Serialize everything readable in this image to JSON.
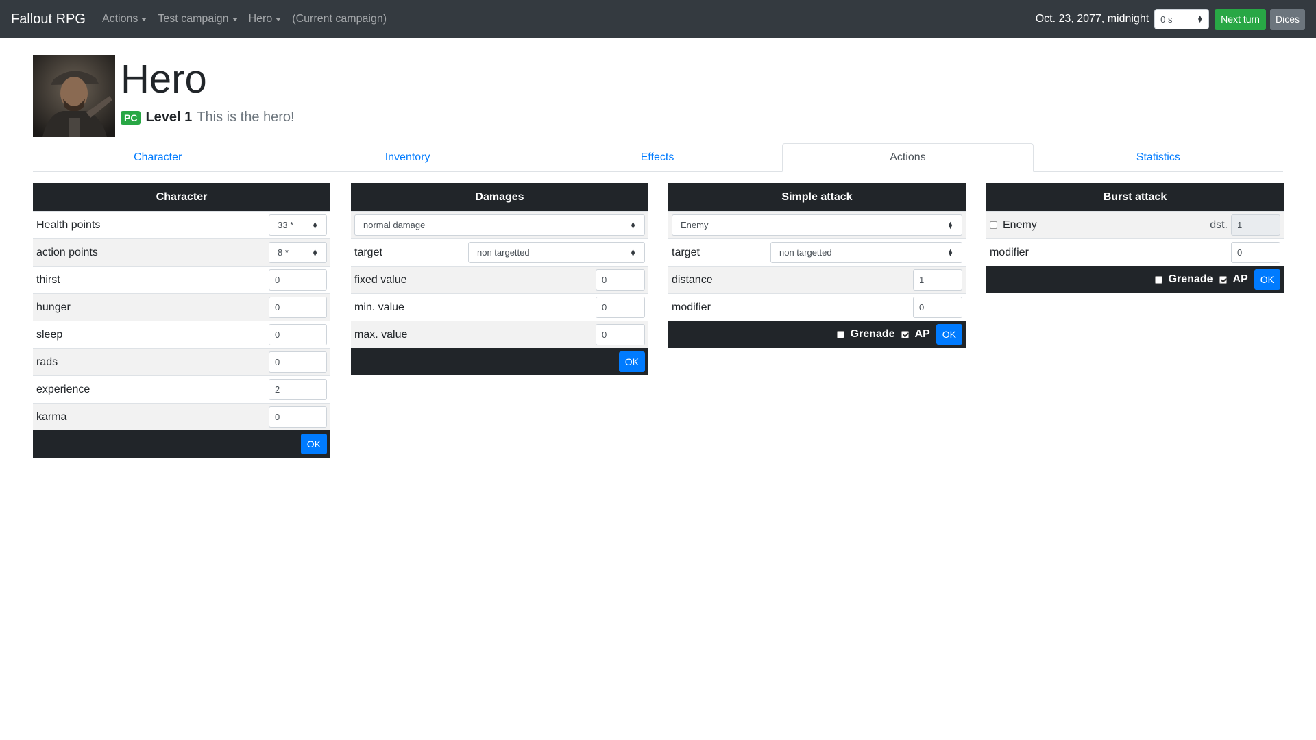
{
  "nav": {
    "brand": "Fallout RPG",
    "menus": [
      "Actions",
      "Test campaign",
      "Hero"
    ],
    "current_campaign": "(Current campaign)",
    "date": "Oct. 23, 2077, midnight",
    "time_select": "0 s",
    "next_turn": "Next turn",
    "dices": "Dices"
  },
  "header": {
    "name": "Hero",
    "badge": "PC",
    "level_label": "Level",
    "level_value": "1",
    "description": "This is the hero!"
  },
  "tabs": [
    {
      "label": "Character",
      "active": false
    },
    {
      "label": "Inventory",
      "active": false
    },
    {
      "label": "Effects",
      "active": false
    },
    {
      "label": "Actions",
      "active": true
    },
    {
      "label": "Statistics",
      "active": false
    }
  ],
  "character": {
    "title": "Character",
    "rows": [
      {
        "label": "Health points",
        "value": "33 *",
        "type": "select"
      },
      {
        "label": "action points",
        "value": "8 *",
        "type": "select"
      },
      {
        "label": "thirst",
        "value": "0"
      },
      {
        "label": "hunger",
        "value": "0"
      },
      {
        "label": "sleep",
        "value": "0"
      },
      {
        "label": "rads",
        "value": "0"
      },
      {
        "label": "experience",
        "value": "2"
      },
      {
        "label": "karma",
        "value": "0"
      }
    ],
    "ok": "OK"
  },
  "damages": {
    "title": "Damages",
    "damage_type": "normal damage",
    "target_label": "target",
    "target_value": "non targetted",
    "fixed_label": "fixed value",
    "fixed_value": "0",
    "min_label": "min. value",
    "min_value": "0",
    "max_label": "max. value",
    "max_value": "0",
    "ok": "OK"
  },
  "simple_attack": {
    "title": "Simple attack",
    "enemy": "Enemy",
    "target_label": "target",
    "target_value": "non targetted",
    "distance_label": "distance",
    "distance_value": "1",
    "modifier_label": "modifier",
    "modifier_value": "0",
    "grenade": "Grenade",
    "ap": "AP",
    "grenade_checked": false,
    "ap_checked": true,
    "ok": "OK"
  },
  "burst_attack": {
    "title": "Burst attack",
    "enemy": "Enemy",
    "dst_label": "dst.",
    "dst_value": "1",
    "modifier_label": "modifier",
    "modifier_value": "0",
    "grenade": "Grenade",
    "ap": "AP",
    "enemy_checked": false,
    "grenade_checked": false,
    "ap_checked": true,
    "ok": "OK"
  }
}
